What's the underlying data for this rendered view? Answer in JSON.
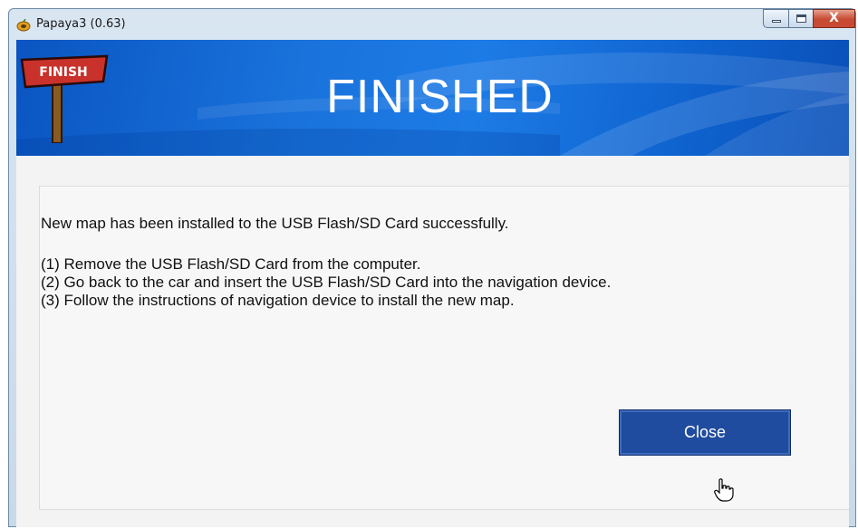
{
  "window": {
    "title": "Papaya3 (0.63)",
    "close_glyph": "X"
  },
  "banner": {
    "title": "FINISHED",
    "sign_text": "FINISH"
  },
  "message": {
    "success": "New map has been installed to the USB Flash/SD Card successfully.",
    "steps": [
      "(1) Remove the USB Flash/SD Card from the computer.",
      "(2) Go back to the car and insert the USB Flash/SD Card into the navigation device.",
      "(3) Follow the instructions of navigation device to install the new map."
    ]
  },
  "buttons": {
    "close_label": "Close"
  },
  "icons": {
    "app": "papaya-icon",
    "sign": "finish-sign-icon",
    "cursor": "hand-pointer-icon"
  },
  "colors": {
    "banner": "#1a73dc",
    "button": "#1f4c9e"
  }
}
